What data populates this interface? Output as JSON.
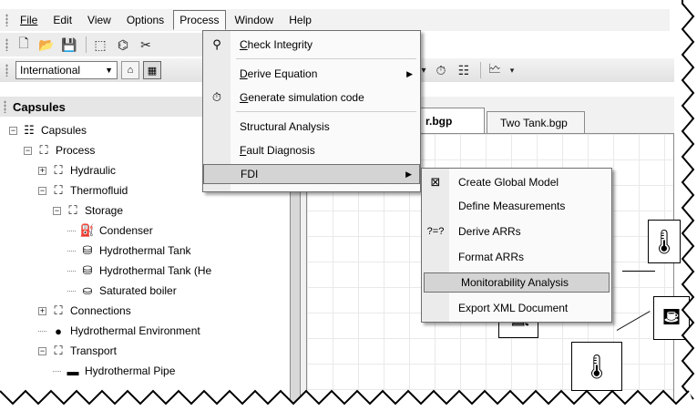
{
  "menubar": {
    "items": [
      {
        "label": "File"
      },
      {
        "label": "Edit"
      },
      {
        "label": "View"
      },
      {
        "label": "Options"
      },
      {
        "label": "Process",
        "open": true
      },
      {
        "label": "Window"
      },
      {
        "label": "Help"
      }
    ]
  },
  "toolbar": {
    "font_select_value": "International"
  },
  "panel": {
    "title": "Capsules",
    "tree": [
      {
        "label": "Capsules",
        "level": 0,
        "expand": "-",
        "icon": "capsules-icon"
      },
      {
        "label": "Process",
        "level": 1,
        "expand": "-",
        "icon": "process-icon"
      },
      {
        "label": "Hydraulic",
        "level": 2,
        "expand": "+",
        "icon": "process-icon"
      },
      {
        "label": "Thermofluid",
        "level": 2,
        "expand": "-",
        "icon": "process-icon"
      },
      {
        "label": "Storage",
        "level": 3,
        "expand": "-",
        "icon": "process-icon"
      },
      {
        "label": "Condenser",
        "level": 4,
        "expand": "",
        "icon": "condenser-icon"
      },
      {
        "label": "Hydrothermal Tank",
        "level": 4,
        "expand": "",
        "icon": "tank-icon"
      },
      {
        "label": "Hydrothermal Tank (He",
        "level": 4,
        "expand": "",
        "icon": "tank-icon"
      },
      {
        "label": "Saturated boiler",
        "level": 4,
        "expand": "",
        "icon": "boiler-icon"
      },
      {
        "label": "Connections",
        "level": 2,
        "expand": "+",
        "icon": "process-icon"
      },
      {
        "label": "Hydrothermal Environment",
        "level": 2,
        "expand": "",
        "icon": "environment-icon"
      },
      {
        "label": "Transport",
        "level": 2,
        "expand": "-",
        "icon": "process-icon"
      },
      {
        "label": "Hydrothermal Pipe",
        "level": 3,
        "expand": "",
        "icon": "pipe-icon"
      }
    ]
  },
  "tabs": [
    {
      "label": "r.bgp",
      "active": true
    },
    {
      "label": "Two Tank.bgp",
      "active": false
    }
  ],
  "process_menu": {
    "items": [
      {
        "label": "Check Integrity",
        "underline": "C",
        "rest": "heck Integrity",
        "icon": "search-icon"
      },
      {
        "label": "Derive Equation",
        "underline": "D",
        "rest": "erive Equation",
        "submenu": true
      },
      {
        "label": "Generate simulation code",
        "underline": "G",
        "rest": "enerate simulation code",
        "icon": "timer-icon"
      },
      {
        "label": "Structural Analysis"
      },
      {
        "label": "Fault Diagnosis",
        "underline": "F",
        "rest": "ault Diagnosis"
      },
      {
        "label": "FDI",
        "submenu": true,
        "highlighted": true
      }
    ]
  },
  "fdi_menu": {
    "items": [
      {
        "label": "Create Global Model",
        "icon": "global-model-icon"
      },
      {
        "label": "Define Measurements"
      },
      {
        "label": "Derive ARRs",
        "icon_text": "?=?"
      },
      {
        "label": "Format ARRs"
      },
      {
        "label": "Monitorability Analysis",
        "highlighted": true
      },
      {
        "label": "Export XML Document"
      }
    ]
  }
}
